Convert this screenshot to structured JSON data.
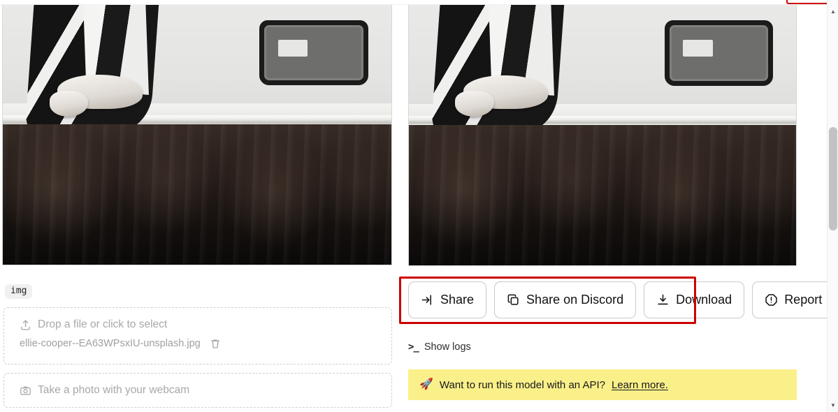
{
  "window": {
    "background": "#ffffff",
    "annotation_color": "#cc0000"
  },
  "output": {
    "panel_left_name": "output-image-left",
    "panel_right_name": "output-image-right"
  },
  "input": {
    "type_chip": "img",
    "dropzone": {
      "prompt": "Drop a file or click to select",
      "filename": "ellie-cooper--EA63WPsxIU-unsplash.jpg",
      "upload_icon": "upload-icon",
      "delete_icon": "trash-icon"
    },
    "webcam": {
      "label": "Take a photo with your webcam",
      "icon": "camera-icon"
    }
  },
  "actions": {
    "buttons": [
      {
        "id": "share",
        "label": "Share",
        "icon": "share-arrow-icon"
      },
      {
        "id": "share-on-discord",
        "label": "Share on Discord",
        "icon": "copy-icon"
      },
      {
        "id": "download",
        "label": "Download",
        "icon": "download-icon"
      },
      {
        "id": "report",
        "label": "Report",
        "icon": "alert-octagon-icon"
      }
    ]
  },
  "logs": {
    "toggle_label": "Show logs",
    "icon": "terminal-prompt-icon",
    "prompt_glyph": ">_"
  },
  "api_banner": {
    "icon": "rocket-icon",
    "emoji": "🚀",
    "text": "Want to run this model with an API?",
    "link_label": "Learn more.",
    "background": "#faf089"
  },
  "scrollbar": {
    "up_glyph": "▲",
    "down_glyph": "▼"
  }
}
